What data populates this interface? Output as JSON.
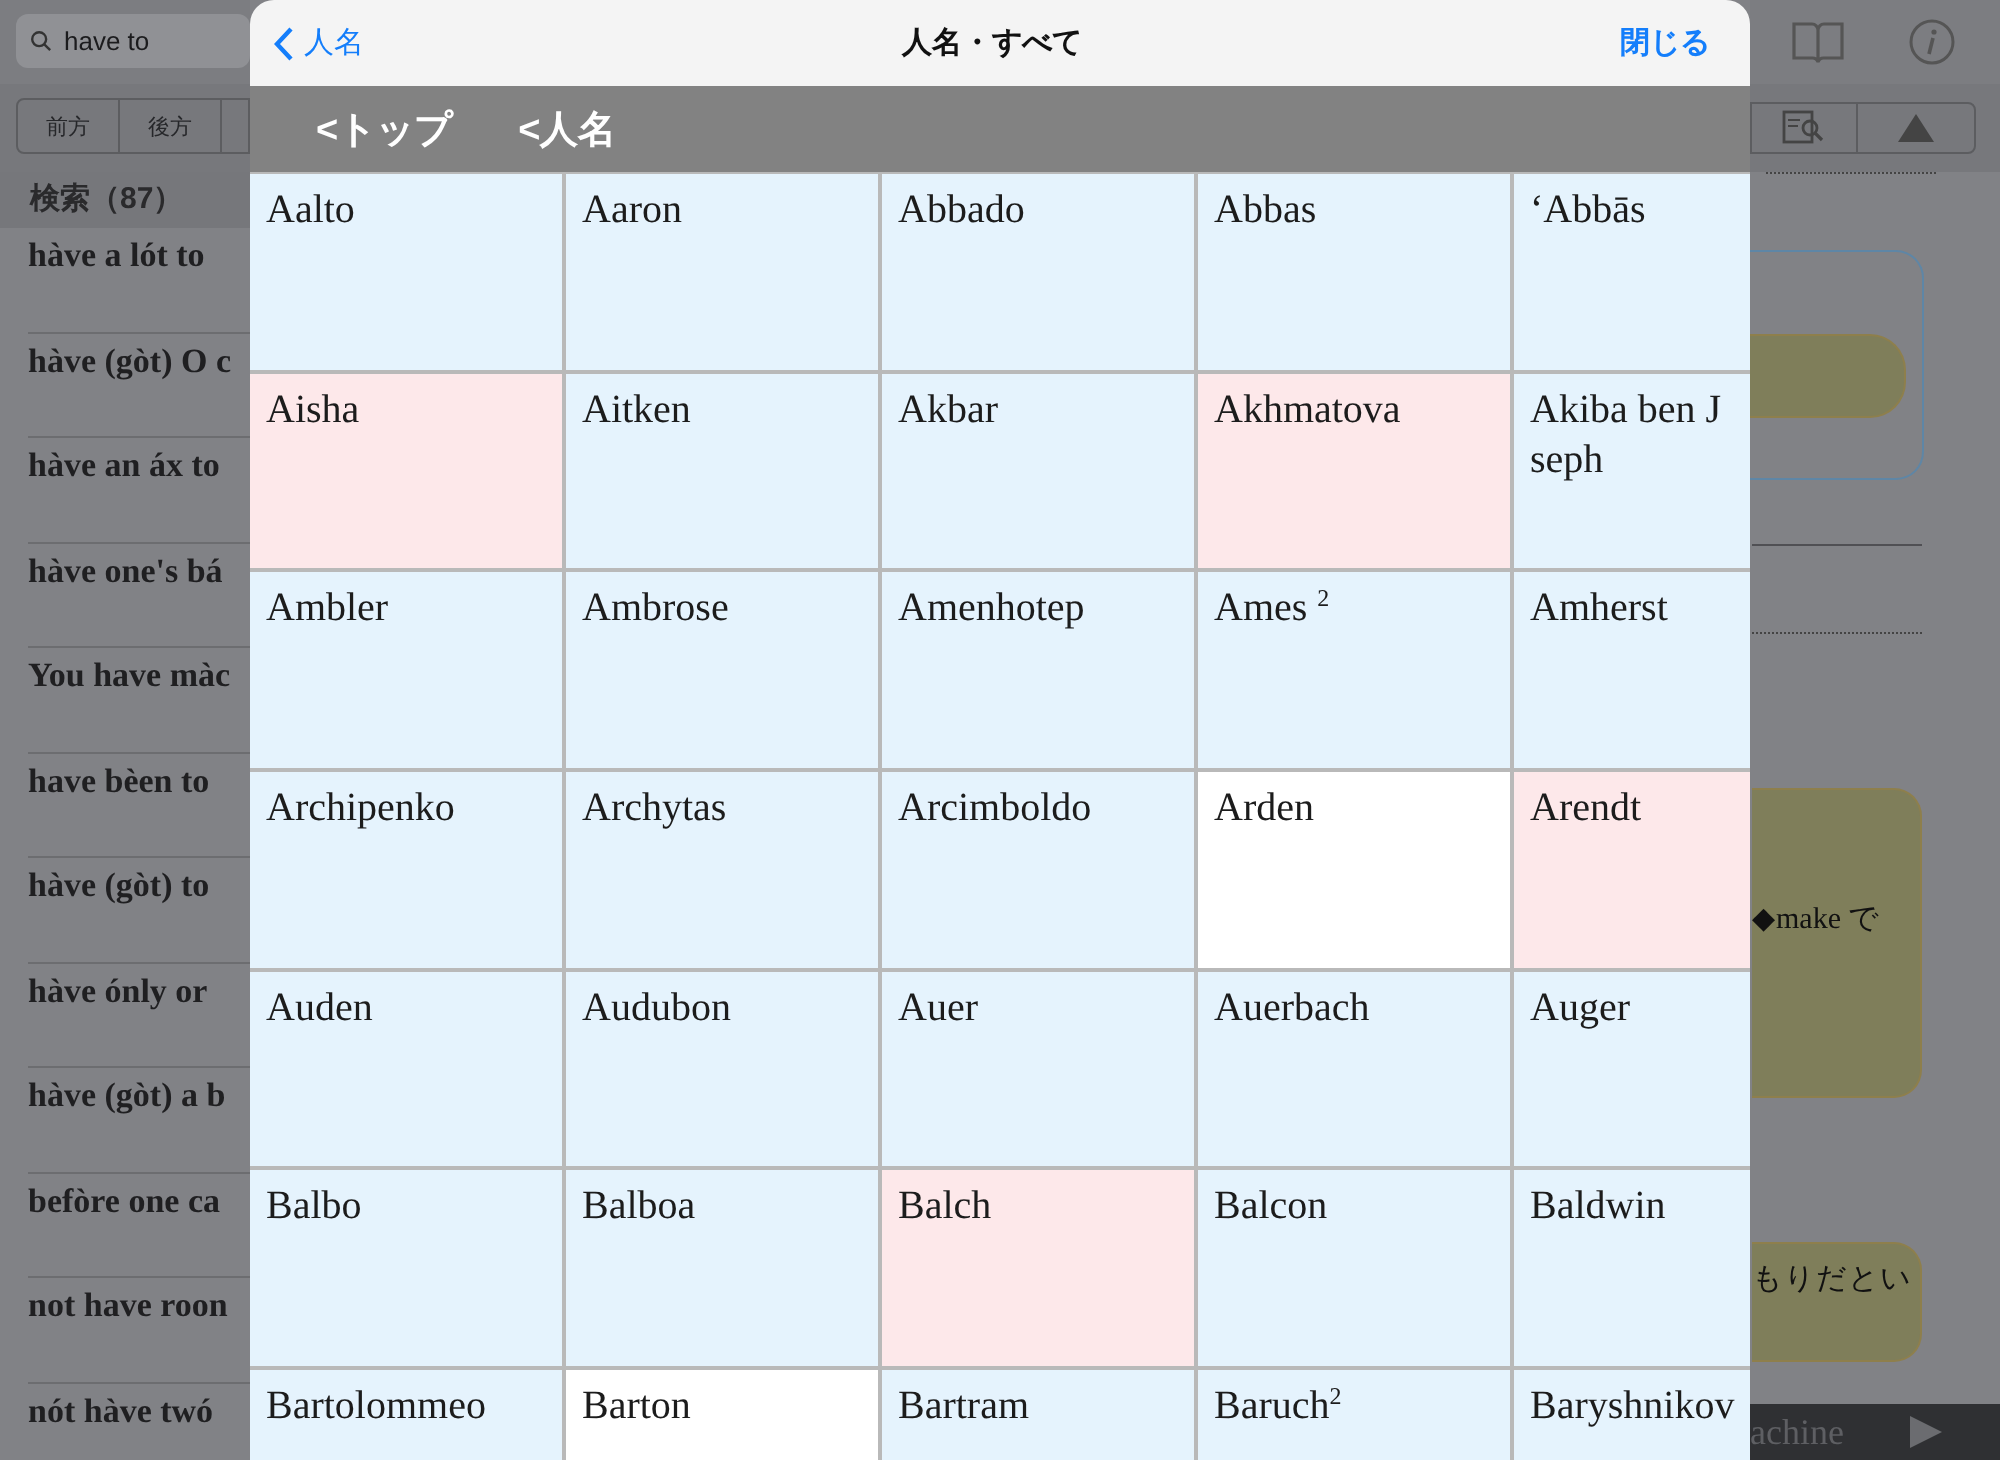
{
  "background": {
    "search": {
      "value": "have to"
    },
    "segments": [
      "前方",
      "後方"
    ],
    "results_header": "検索（87）",
    "results": [
      "hàve a lót to",
      "hàve (gòt) O c",
      "hàve an áx to",
      "hàve one's bá",
      "You have màc",
      "have bèen to",
      "hàve (gòt) to",
      "hàve ónly  or",
      "hàve (gòt) a b",
      "befòre one ca",
      "not have roon",
      "nót hàve twó"
    ],
    "right_texts": [
      "◆make で",
      "もりだとい"
    ],
    "bottom_bar": "achine"
  },
  "dialog": {
    "back": "人名",
    "title": "人名・すべて",
    "close": "閉じる",
    "breadcrumbs": [
      "<トップ",
      "<人名"
    ],
    "cells": [
      [
        {
          "name": "Aalto",
          "color": "#e5f3fd"
        },
        {
          "name": "Aaron",
          "color": "#e5f3fd"
        },
        {
          "name": "Abbado",
          "color": "#e5f3fd"
        },
        {
          "name": "Abbas",
          "color": "#e5f3fd"
        },
        {
          "name": "‘Abbās",
          "color": "#e5f3fd"
        }
      ],
      [
        {
          "name": "Aisha",
          "color": "#fde8ea"
        },
        {
          "name": "Aitken",
          "color": "#e5f3fd"
        },
        {
          "name": "Akbar",
          "color": "#e5f3fd"
        },
        {
          "name": "Akhmatova",
          "color": "#fde8ea"
        },
        {
          "name": "Akiba ben J\nseph",
          "color": "#e5f3fd"
        }
      ],
      [
        {
          "name": "Ambler",
          "color": "#e5f3fd"
        },
        {
          "name": "Ambrose",
          "color": "#e5f3fd"
        },
        {
          "name": "Amenhotep",
          "color": "#e5f3fd"
        },
        {
          "name": "Ames $^{2}$",
          "color": "#e5f3fd"
        },
        {
          "name": "Amherst",
          "color": "#e5f3fd"
        }
      ],
      [
        {
          "name": "Archipenko",
          "color": "#e5f3fd"
        },
        {
          "name": "Archytas",
          "color": "#e5f3fd"
        },
        {
          "name": "Arcimboldo",
          "color": "#e5f3fd"
        },
        {
          "name": "Arden",
          "color": "#ffffff"
        },
        {
          "name": "Arendt",
          "color": "#fde8ea"
        }
      ],
      [
        {
          "name": "Auden",
          "color": "#e5f3fd"
        },
        {
          "name": "Audubon",
          "color": "#e5f3fd"
        },
        {
          "name": "Auer",
          "color": "#e5f3fd"
        },
        {
          "name": "Auerbach",
          "color": "#e5f3fd"
        },
        {
          "name": "Auger",
          "color": "#e5f3fd"
        }
      ],
      [
        {
          "name": "Balbo",
          "color": "#e5f3fd"
        },
        {
          "name": "Balboa",
          "color": "#e5f3fd"
        },
        {
          "name": "Balch",
          "color": "#fde8ea"
        },
        {
          "name": "Balcon",
          "color": "#e5f3fd"
        },
        {
          "name": "Baldwin",
          "color": "#e5f3fd"
        }
      ],
      [
        {
          "name": "Bartolommeo",
          "color": "#e5f3fd"
        },
        {
          "name": "Barton",
          "color": "#ffffff"
        },
        {
          "name": "Bartram",
          "color": "#e5f3fd"
        },
        {
          "name": "Baruch$^{2}$",
          "color": "#e5f3fd"
        },
        {
          "name": "Baryshnikov",
          "color": "#e5f3fd"
        }
      ]
    ]
  }
}
